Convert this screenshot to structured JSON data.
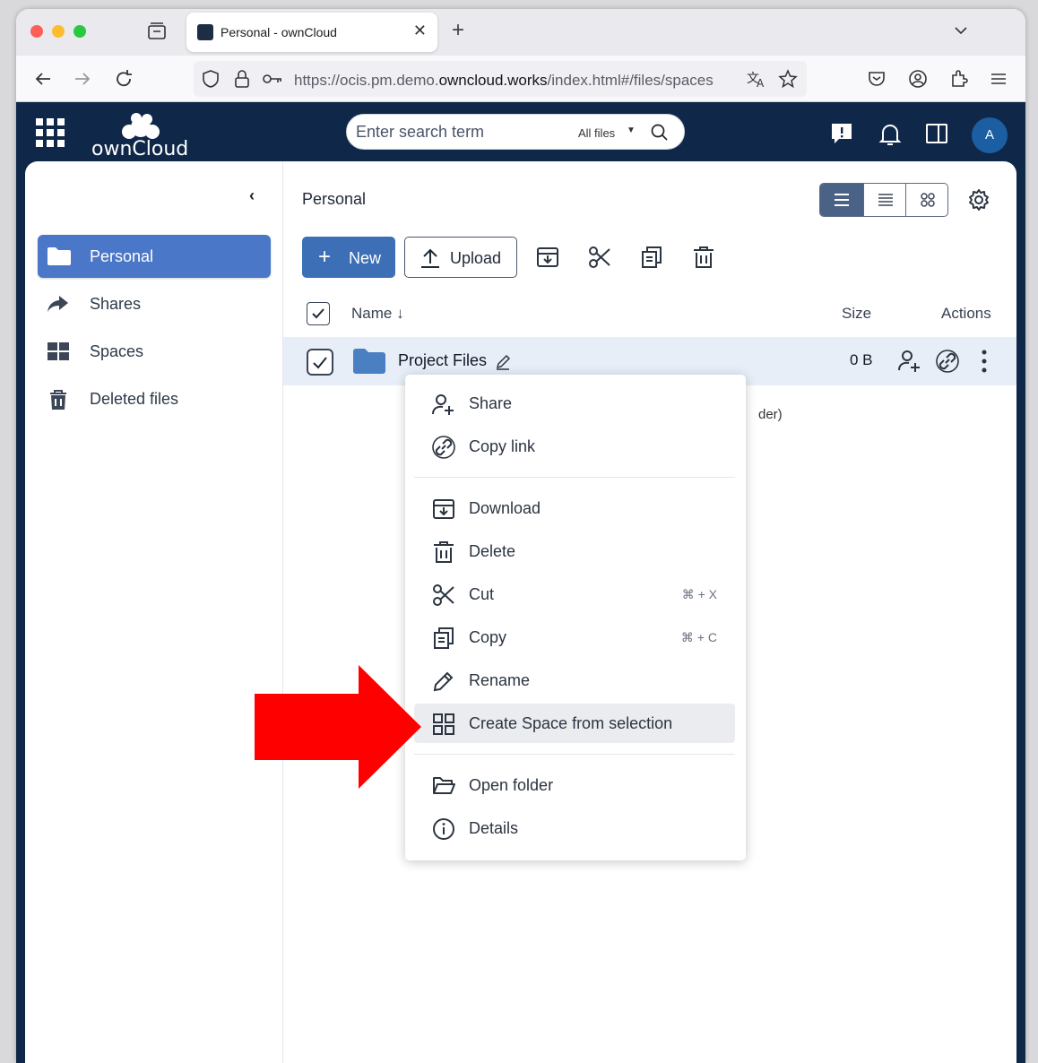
{
  "browser": {
    "tab_title": "Personal - ownCloud",
    "url_prefix": "https://ocis.pm.demo.",
    "url_domain": "owncloud.works",
    "url_suffix": "/index.html#/files/spaces"
  },
  "app": {
    "logo_text": "ownCloud",
    "search": {
      "placeholder": "Enter search term",
      "scope": "All files"
    },
    "avatar_initial": "A",
    "colors": {
      "header": "#0f2849",
      "primary": "#3d6fb6",
      "sidebar_active": "#4a77c7",
      "arrow": "#ff0000"
    }
  },
  "sidebar": {
    "items": [
      {
        "label": "Personal",
        "icon": "folder-icon",
        "active": true
      },
      {
        "label": "Shares",
        "icon": "share-arrow-icon"
      },
      {
        "label": "Spaces",
        "icon": "spaces-grid-icon"
      },
      {
        "label": "Deleted files",
        "icon": "trash-icon"
      }
    ]
  },
  "main": {
    "breadcrumb": "Personal",
    "new_label": "New",
    "upload_label": "Upload",
    "columns": {
      "name": "Name",
      "size": "Size",
      "actions": "Actions"
    },
    "rows": [
      {
        "name": "Project Files",
        "size": "0 B"
      }
    ],
    "partial_text": "der)"
  },
  "context_menu": {
    "items": [
      {
        "label": "Share",
        "icon": "share-user-icon"
      },
      {
        "label": "Copy link",
        "icon": "link-icon"
      },
      {
        "label": "Download",
        "icon": "download-icon"
      },
      {
        "label": "Delete",
        "icon": "delete-icon"
      },
      {
        "label": "Cut",
        "icon": "scissors-icon",
        "shortcut": "⌘ + X"
      },
      {
        "label": "Copy",
        "icon": "copy-icon",
        "shortcut": "⌘ + C"
      },
      {
        "label": "Rename",
        "icon": "pencil-icon"
      },
      {
        "label": "Create Space from selection",
        "icon": "spaces-grid-icon",
        "highlighted": true
      },
      {
        "label": "Open folder",
        "icon": "folder-open-icon"
      },
      {
        "label": "Details",
        "icon": "info-icon"
      }
    ]
  }
}
